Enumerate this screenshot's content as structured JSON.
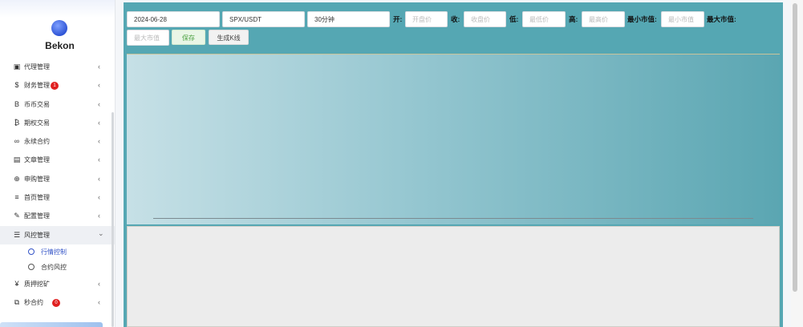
{
  "brand": {
    "name": "Bekon"
  },
  "sidebar": {
    "items": [
      {
        "label": "代理管理",
        "icon": "id-card-icon",
        "glyph": "▣",
        "badge": ""
      },
      {
        "label": "财务管理",
        "icon": "dollar-icon",
        "glyph": "$",
        "badge": "1"
      },
      {
        "label": "币币交易",
        "icon": "bitcoin-icon",
        "glyph": "B",
        "badge": ""
      },
      {
        "label": "期权交易",
        "icon": "bitcoin-small-icon",
        "glyph": "₿",
        "badge": ""
      },
      {
        "label": "永续合约",
        "icon": "link-icon",
        "glyph": "∞",
        "badge": ""
      },
      {
        "label": "文章管理",
        "icon": "newspaper-icon",
        "glyph": "▤",
        "badge": ""
      },
      {
        "label": "申购管理",
        "icon": "lifebuoy-icon",
        "glyph": "⊕",
        "badge": ""
      },
      {
        "label": "首页管理",
        "icon": "list-icon",
        "glyph": "≡",
        "badge": ""
      },
      {
        "label": "配置管理",
        "icon": "wrench-icon",
        "glyph": "✎",
        "badge": ""
      },
      {
        "label": "风控管理",
        "icon": "tasks-icon",
        "glyph": "☰",
        "badge": ""
      }
    ],
    "sub_items": [
      {
        "label": "行情控制"
      },
      {
        "label": "合约风控"
      }
    ],
    "items_after": [
      {
        "label": "质押挖矿",
        "icon": "yen-icon",
        "glyph": "¥",
        "badge": ""
      },
      {
        "label": "秒合约",
        "icon": "copy-icon",
        "glyph": "⧉",
        "badge": "0"
      }
    ],
    "chevron_collapsed": "‹",
    "chevron_expanded": "⌄"
  },
  "toolbar": {
    "date_value": "2024-06-28",
    "symbol_value": "SPX/USDT",
    "interval_value": "30分钟",
    "open_label": "开:",
    "open_placeholder": "开盘价",
    "close_label": "收:",
    "close_placeholder": "收盘价",
    "low_label": "低:",
    "low_placeholder": "最低价",
    "high_label": "高:",
    "high_placeholder": "最高价",
    "min_cap_label": "最小市值:",
    "min_cap_placeholder": "最小市值",
    "max_cap_label": "最大市值:",
    "max_cap_placeholder": "最大市值",
    "save_label": "保存",
    "generate_label": "生成K线"
  },
  "colors": {
    "accent": "#3353c7",
    "badge": "#e02020",
    "save_green": "#4aa03f",
    "main_teal": "#55a7b3"
  }
}
